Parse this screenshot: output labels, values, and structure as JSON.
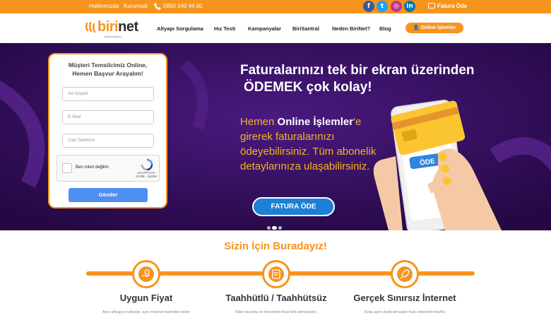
{
  "topbar": {
    "links": [
      "Hakkımızda",
      "Kurumsal"
    ],
    "phone": "0850 340 44 00",
    "social": [
      {
        "icon": "facebook-icon",
        "glyph": "f",
        "color": "#3b5998"
      },
      {
        "icon": "twitter-icon",
        "glyph": "t",
        "color": "#1da1f2"
      },
      {
        "icon": "instagram-icon",
        "glyph": "◎",
        "color": "#c13584"
      },
      {
        "icon": "linkedin-icon",
        "glyph": "in",
        "color": "#0077b5"
      }
    ],
    "fatura_ode": "Fatura Öde"
  },
  "nav": {
    "logo_main": "biri",
    "logo_accent": "net",
    "logo_sub": "Telekomünikasyon",
    "items": [
      "Altyapı Sorgulama",
      "Hız Testi",
      "Kampanyalar",
      "BiriSantral",
      "Neden BiriNet?",
      "Blog"
    ],
    "online_button": "Online İşlemler"
  },
  "form": {
    "title_line1": "Müşteri Temsilcimiz Online,",
    "title_line2": "Hemen Başvur Arayalım!",
    "name_placeholder": "Ad Soyad",
    "email_placeholder": "E-Mail",
    "phone_placeholder": "Cep Telefonu",
    "captcha_label": "Ben robot değilim",
    "captcha_brand": "reCAPTCHA",
    "captcha_links": "Gizlilik - Şartlar",
    "submit": "Gönder"
  },
  "hero": {
    "headline_line1": "Faturalarınızı tek bir ekran üzerinden",
    "headline_line2": "ÖDEMEK çok kolay!",
    "sub_pre": "Hemen ",
    "sub_bold": "Online İşlemler",
    "sub_post": "'e girerek faturalarınızı ödeyebilirsiniz. Tüm abonelik detaylarınıza ulaşabilirsiniz.",
    "cta": "FATURA ÖDE",
    "phone_button": "ÖDE",
    "slides": 3,
    "active_slide": 2
  },
  "features": {
    "section_title": "Sizin İçin Buradayız!",
    "items": [
      {
        "title": "Uygun Fiyat",
        "desc": "Aynı altyapıyı kullanıp, aynı internet hizmetini sizler",
        "icon": "money-hand-icon"
      },
      {
        "title": "Taahhütlü / Taahhütsüz",
        "desc": "Fiber hızında ev internetini fiyat fark etmeksizin,",
        "icon": "contract-icon"
      },
      {
        "title": "Gerçek Sınırsız İnternet",
        "desc": "Kota aşım derdi olmadan hızlı internetin keyfini",
        "icon": "rocket-icon"
      }
    ]
  },
  "colors": {
    "brand_orange": "#f7941d",
    "hero_purple": "#2e0c55",
    "button_blue": "#1d7fd6"
  }
}
